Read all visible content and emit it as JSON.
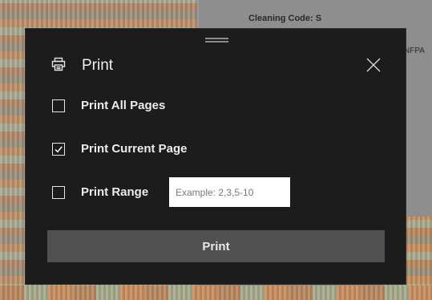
{
  "background": {
    "cleaning_code": "Cleaning Code: S",
    "side_text": "NFPA"
  },
  "dialog": {
    "title": "Print",
    "icons": {
      "title": "printer-icon",
      "close": "close-icon",
      "check": "check-icon"
    },
    "options": [
      {
        "label": "Print All Pages",
        "checked": false
      },
      {
        "label": "Print Current Page",
        "checked": true
      },
      {
        "label": "Print Range",
        "checked": false
      }
    ],
    "range_input": {
      "value": "",
      "placeholder": "Example: 2,3,5-10"
    },
    "print_button": "Print"
  },
  "colors": {
    "dialog_bg": "#1c1c1c",
    "button_bg": "#505050",
    "text": "#f0f0f0"
  }
}
